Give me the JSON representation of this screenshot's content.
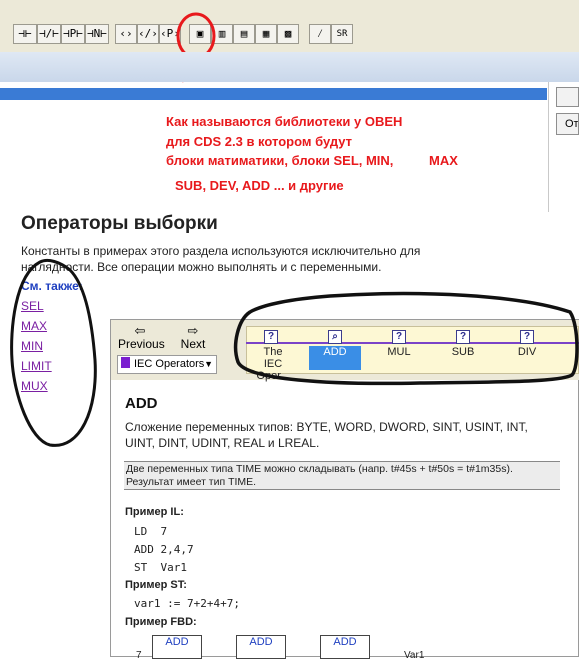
{
  "toolbar": {
    "buttons": [
      "⊣⊢",
      "⊣/⊢",
      "⊣P⊢",
      "⊣N⊢",
      "‹›",
      "‹/›",
      "‹P›",
      "▣",
      "▥",
      "▤",
      "▦",
      "▩",
      "⁄",
      "SR"
    ]
  },
  "annotation": {
    "line1": "Как называются библиотеки у ОВЕН",
    "line2": "для CDS 2.3 в котором будут",
    "line3": "блоки матиматики, блоки SEL, MIN,",
    "line3b": "MAX",
    "line4": "SUB, DEV, ADD ... и другие"
  },
  "help": {
    "title": "Операторы выборки",
    "intro": "Константы в примерах этого раздела используются исключительно для наглядности. Все операции можно выполнять и с переменными.",
    "see_also": "См. также:",
    "links": [
      "SEL",
      "MAX",
      "MIN",
      "LIMIT",
      "MUX"
    ]
  },
  "right_button": "От",
  "window": {
    "previous": "Previous",
    "next": "Next",
    "dropdown_value": "IEC Operators",
    "topics": [
      {
        "label1": "The",
        "label2": "IEC Oper...",
        "selected": false
      },
      {
        "label1": "ADD",
        "label2": "",
        "selected": true
      },
      {
        "label1": "MUL",
        "label2": "",
        "selected": false
      },
      {
        "label1": "SUB",
        "label2": "",
        "selected": false
      },
      {
        "label1": "DIV",
        "label2": "",
        "selected": false
      }
    ],
    "heading": "ADD",
    "description": "Сложение переменных типов: BYTE, WORD, DWORD, SINT, USINT, INT, UINT, DINT, UDINT, REAL и LREAL.",
    "note": "Две переменных типа TIME можно складывать (напр. t#45s + t#50s = t#1m35s). Результат имеет тип TIME.",
    "il_label": "Пример IL:",
    "il_code": [
      "LD  7",
      "ADD 2,4,7",
      "ST  Var1"
    ],
    "st_label": "Пример ST:",
    "st_code": "var1 := 7+2+4+7;",
    "fbd_label": "Пример FBD:",
    "fbd_blocks": [
      "ADD",
      "ADD",
      "ADD"
    ],
    "fbd_left": "7",
    "fbd_right": "Var1"
  },
  "colors": {
    "annotation": "#e8191c",
    "selected_topic": "#3a8ee6",
    "link": "#7a1fa2"
  }
}
